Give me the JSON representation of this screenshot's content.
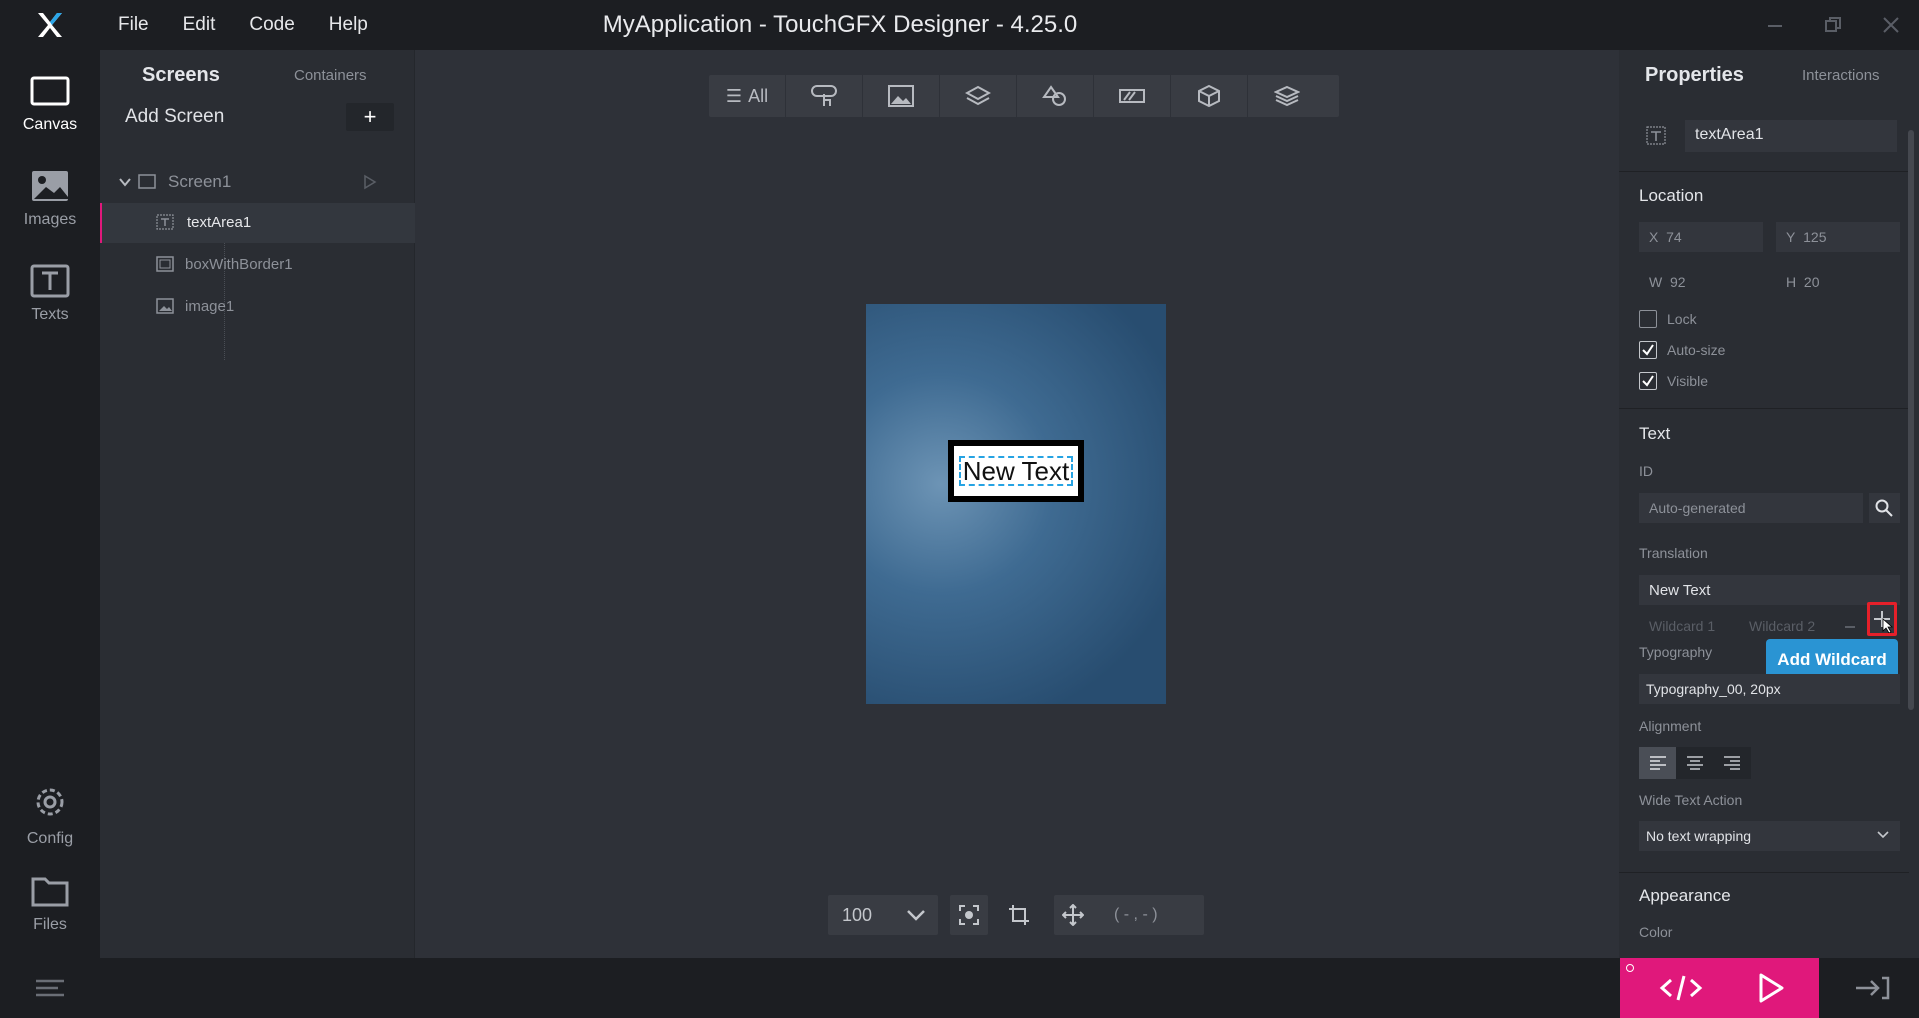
{
  "app": {
    "title": "MyApplication - TouchGFX Designer - 4.25.0",
    "menu": [
      "File",
      "Edit",
      "Code",
      "Help"
    ]
  },
  "rail": {
    "items": [
      {
        "label": "Canvas",
        "icon": "canvas-icon"
      },
      {
        "label": "Images",
        "icon": "images-icon"
      },
      {
        "label": "Texts",
        "icon": "texts-icon"
      },
      {
        "label": "Config",
        "icon": "gear-icon"
      },
      {
        "label": "Files",
        "icon": "folder-icon"
      }
    ]
  },
  "tree": {
    "tab_screens": "Screens",
    "tab_containers": "Containers",
    "add_screen": "Add Screen",
    "add_symbol": "+",
    "screen": "Screen1",
    "widgets": [
      "textArea1",
      "boxWithBorder1",
      "image1"
    ]
  },
  "canvas": {
    "toolbar_all": "All",
    "preview_text": "New Text",
    "zoom": "100",
    "coords": "( - , - )"
  },
  "props": {
    "tab_properties": "Properties",
    "tab_interactions": "Interactions",
    "widget_name": "textArea1",
    "location": {
      "title": "Location",
      "x_label": "X",
      "x": "74",
      "y_label": "Y",
      "y": "125",
      "w_label": "W",
      "w": "92",
      "h_label": "H",
      "h": "20",
      "lock": "Lock",
      "autosize": "Auto-size",
      "visible": "Visible"
    },
    "text": {
      "title": "Text",
      "id_label": "ID",
      "id_placeholder": "Auto-generated",
      "translation_label": "Translation",
      "translation": "New Text",
      "wildcard1": "Wildcard 1",
      "wildcard2": "Wildcard 2",
      "typography_label": "Typography",
      "typography": "Typography_00, 20px",
      "alignment_label": "Alignment",
      "wide_text_label": "Wide Text Action",
      "wide_text": "No text wrapping"
    },
    "appearance": {
      "title": "Appearance",
      "color_label": "Color"
    },
    "tooltip": "Add Wildcard"
  },
  "colors": {
    "accent": "#e0187b",
    "tooltip": "#2a94d3",
    "highlight_red": "#e5202a"
  }
}
